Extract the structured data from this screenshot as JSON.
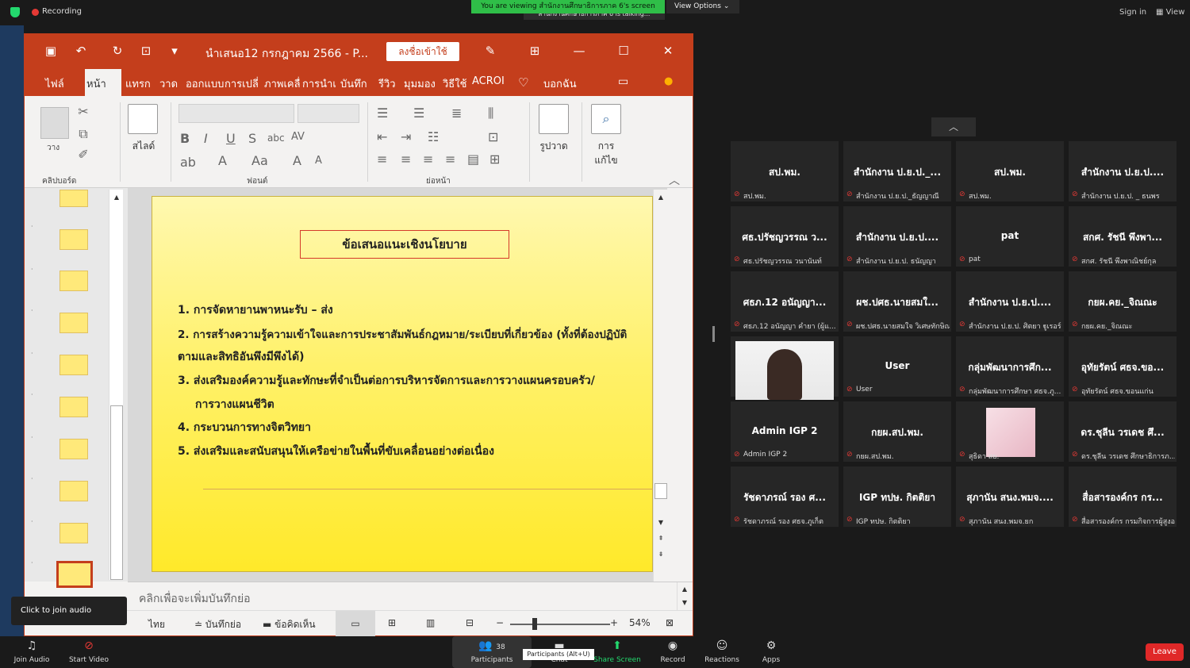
{
  "meeting": {
    "recording_label": "Recording",
    "viewing_banner": "You are viewing สำนักงานศึกษาธิการภาค 6's screen",
    "talking_label": "สำนักงานศึกษาธิการภาค 6 is talking...",
    "view_options": "View Options",
    "sign_in": "Sign in",
    "view": "View"
  },
  "ppt": {
    "doc_title": "นำเสนอ12 กรกฎาคม 2566  -  P...",
    "sign_in_button": "ลงชื่อเข้าใช้",
    "tabs": [
      "ไฟล์",
      "หน้าแรก",
      "แทรก",
      "วาด",
      "ออกแบบ",
      "การเปลี่",
      "ภาพเคลื่",
      "การนำเ",
      "บันทึก",
      "รีวิว",
      "มุมมอง",
      "วิธีใช้",
      "ACROI",
      "บอกฉัน"
    ],
    "ribbon": {
      "clipboard_label": "คลิปบอร์ด",
      "paste_label": "วาง",
      "slide_button": "สไลด์",
      "font_label": "ฟอนต์",
      "paragraph_label": "ย่อหน้า",
      "shapes_button": "รูปวาด",
      "editing_button_1": "การ",
      "editing_button_2": "แก้ไข"
    },
    "slide": {
      "title": "ข้อเสนอแนะเชิงนโยบาย",
      "lines": [
        "1. การจัดหายานพาหนะรับ – ส่ง",
        "2. การสร้างความรู้ความเข้าใจและการประชาสัมพันธ์กฎหมาย/ระเบียบที่เกี่ยวข้อง (ทั้งที่ต้องปฏิบัติ",
        "ตามและสิทธิอันพึงมีพึงได้)",
        "3. ส่งเสริมองค์ความรู้และทักษะที่จำเป็นต่อการบริหารจัดการและการวางแผนครอบครัว/",
        "การวางแผนชีวิต",
        "4. กระบวนการทางจิตวิทยา",
        "5. ส่งเสริมและสนับสนุนให้เครือข่ายในพื้นที่ขับเคลื่อนอย่างต่อเนื่อง"
      ]
    },
    "notes_placeholder": "คลิกเพื่อจะเพิ่มบันทึกย่อ",
    "status": {
      "language": "ไทย",
      "notes_button": "บันทึกย่อ",
      "comments_button": "ข้อคิดเห็น",
      "zoom": "54%"
    },
    "join_audio_tip": "Click to join audio"
  },
  "participants": [
    {
      "main": "สป.พม.",
      "sub": "สป.พม."
    },
    {
      "main": "สำนักงาน ป.ย.ป._...",
      "sub": "สำนักงาน ป.ย.ป._ธัญญาณี"
    },
    {
      "main": "สป.พม.",
      "sub": "สป.พม."
    },
    {
      "main": "สำนักงาน ป.ย.ป....",
      "sub": "สำนักงาน ป.ย.ป. _ ธนพร"
    },
    {
      "main": "ศธ.ปรัชญวรรณ ว...",
      "sub": "ศธ.ปรัชญวรรณ วนานันท์"
    },
    {
      "main": "สำนักงาน ป.ย.ป....",
      "sub": "สำนักงาน ป.ย.ป. ธนัญญา"
    },
    {
      "main": "pat",
      "sub": "pat"
    },
    {
      "main": "สกศ. รัชนี พึงพา...",
      "sub": "สกศ. รัชนี พึงพาณิชย์กุล"
    },
    {
      "main": "ศธภ.12 อนัญญา...",
      "sub": "ศธภ.12 อนัญญา คำยา (ผู้แ..."
    },
    {
      "main": "ผช.ปศธ.นายสมใ...",
      "sub": "ผช.ปศธ.นายสมใจ วิเศษทักษิณ"
    },
    {
      "main": "สำนักงาน ป.ย.ป....",
      "sub": "สำนักงาน ป.ย.ป. ศิตยา ฐูเรอร์"
    },
    {
      "main": "กยผ.คย._จิณณะ",
      "sub": "กยผ.คย._จิณณะ"
    },
    {
      "main": "",
      "sub": ""
    },
    {
      "main": "User",
      "sub": "User"
    },
    {
      "main": "กลุ่มพัฒนาการศึก...",
      "sub": "กลุ่มพัฒนาการศึกษา ศธจ.ภู..."
    },
    {
      "main": "อุทัยรัตน์ ศธจ.ขอ...",
      "sub": "อุทัยรัตน์ ศธจ.ขอนแก่น"
    },
    {
      "main": "Admin IGP 2",
      "sub": "Admin IGP 2"
    },
    {
      "main": "กยผ.สป.พม.",
      "sub": "กยผ.สป.พม."
    },
    {
      "main": "",
      "sub": "สุธิดา สย."
    },
    {
      "main": "ดร.ชุลีน วรเดช ศึ...",
      "sub": "ดร.ชุลีน วรเดช ศึกษาธิการภ..."
    },
    {
      "main": "รัชดาภรณ์ รอง ศ...",
      "sub": "รัชดาภรณ์ รอง ศธจ.ภูเก็ต"
    },
    {
      "main": "IGP ทปษ. กิตติยา",
      "sub": "IGP ทปษ. กิตติยา"
    },
    {
      "main": "สุภานัน สนง.พมจ....",
      "sub": "สุภานัน สนง.พมจ.ยก"
    },
    {
      "main": "สื่อสารองค์กร กร...",
      "sub": "สื่อสารองค์กร กรมกิจการผู้สูงอายุ"
    }
  ],
  "toolbar": {
    "join_audio": "Join Audio",
    "start_video": "Start Video",
    "participants": "Participants",
    "participants_count": "38",
    "participants_tip": "Participants (Alt+U)",
    "chat": "Chat",
    "share_screen": "Share Screen",
    "record": "Record",
    "reactions": "Reactions",
    "apps": "Apps",
    "leave": "Leave"
  },
  "colors": {
    "ppt_accent": "#c43e1c",
    "share_green": "#23d96e",
    "leave_red": "#e02828"
  }
}
